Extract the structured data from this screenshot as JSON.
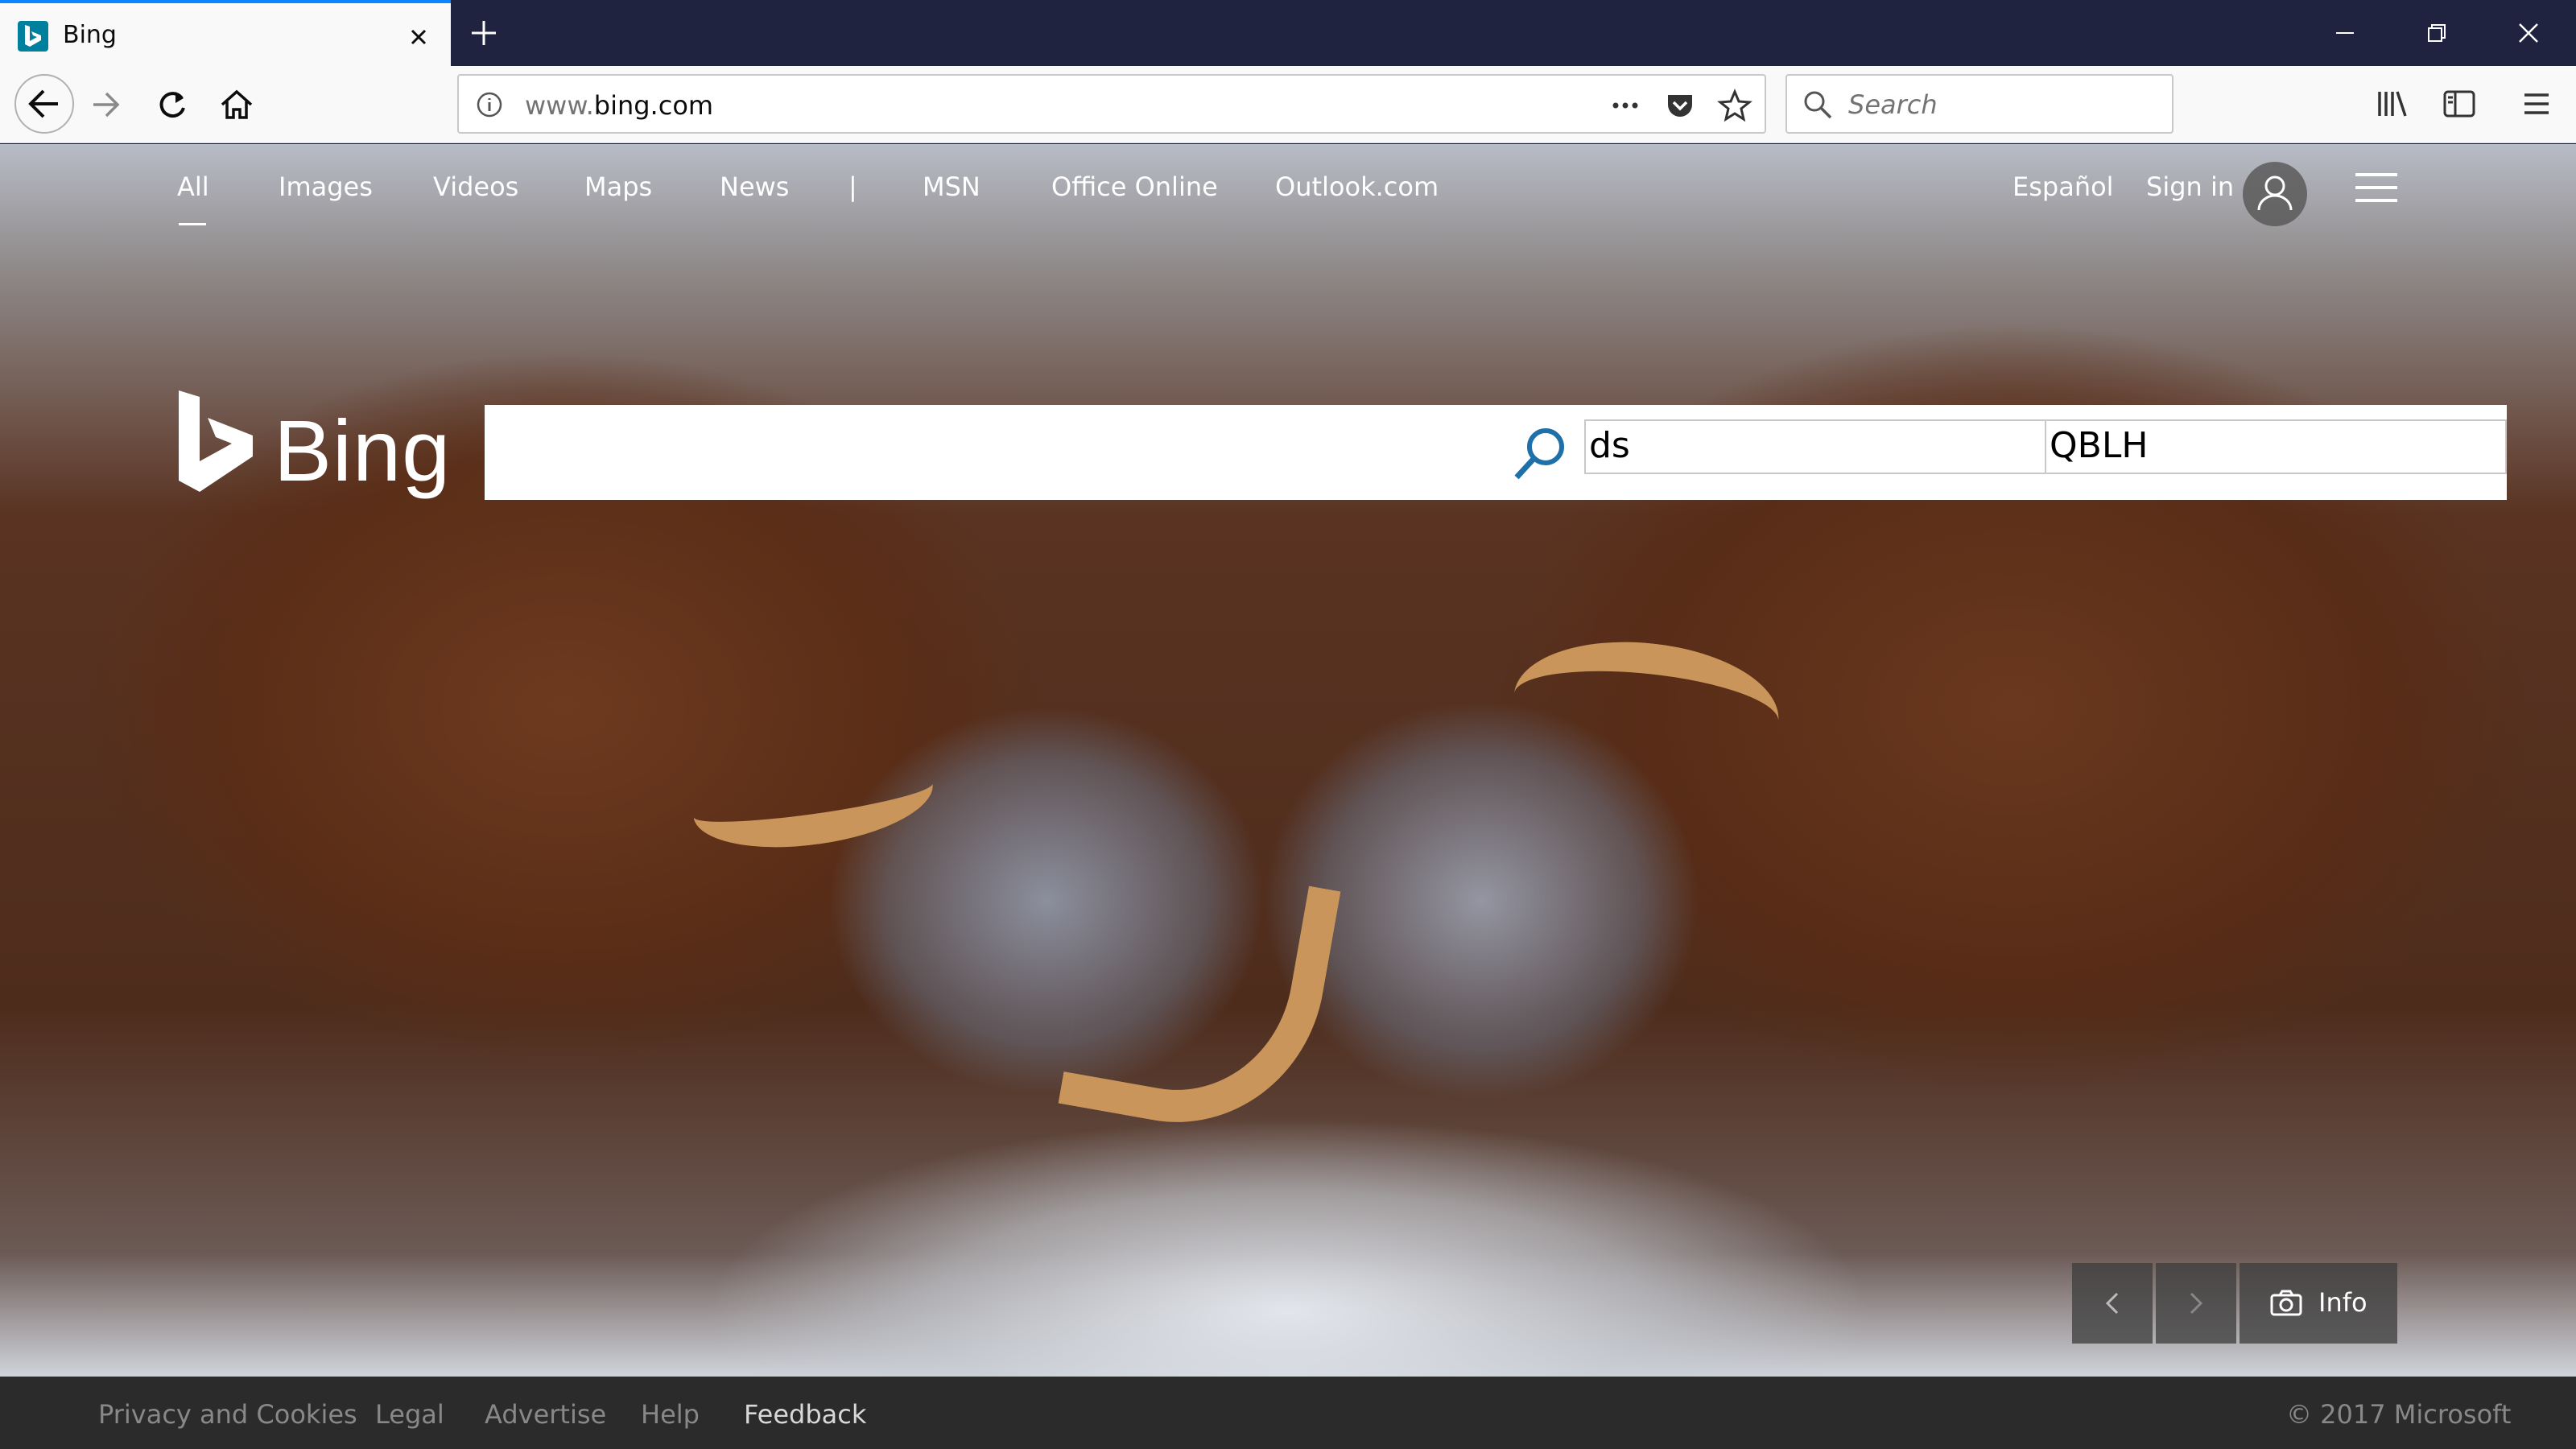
{
  "browser": {
    "tab_title": "Bing",
    "url_host": "www.",
    "url_domain": "bing.com",
    "search_placeholder": "Search"
  },
  "bing_nav": {
    "items": [
      "All",
      "Images",
      "Videos",
      "Maps",
      "News",
      "MSN",
      "Office Online",
      "Outlook.com"
    ],
    "divider": "|",
    "language": "Español",
    "sign_in": "Sign in"
  },
  "logo_text": "Bing",
  "search": {
    "query_left": "ds",
    "query_right": "QBLH"
  },
  "carousel": {
    "info_label": "Info"
  },
  "footer": {
    "links": [
      "Privacy and Cookies",
      "Legal",
      "Advertise",
      "Help",
      "Feedback"
    ],
    "copyright": "© 2017 Microsoft"
  },
  "colors": {
    "accent": "#0a84ff",
    "bing_teal": "#00809d",
    "chrome_dark": "#202340",
    "search_icon": "#1f6fa8"
  }
}
